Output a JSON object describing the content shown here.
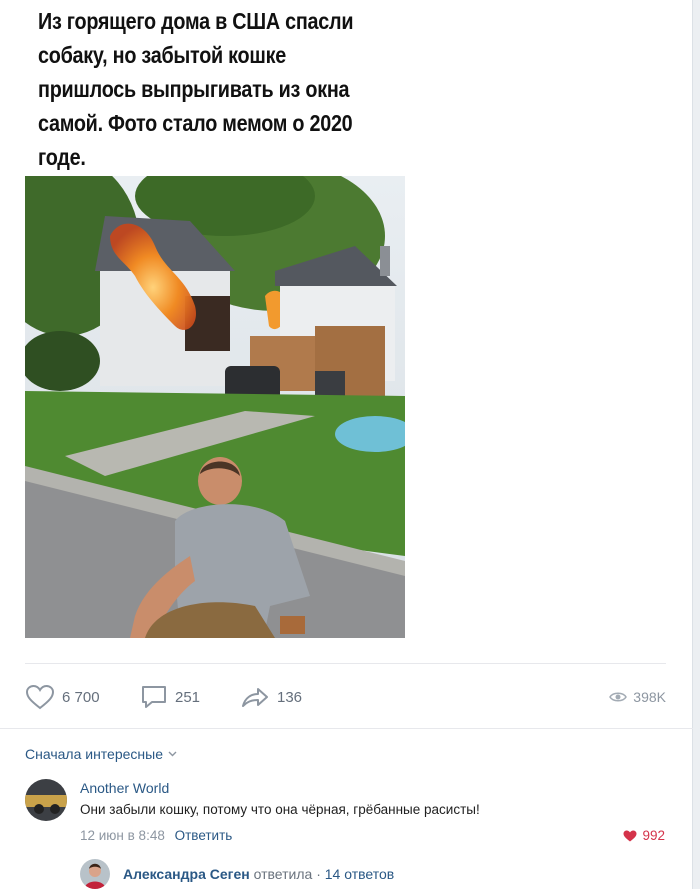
{
  "post": {
    "text_lines": [
      "Из горящего дома в США спасли",
      "собаку, но забытой кошке",
      "пришлось выпрыгивать из окна",
      "самой. Фото стало мемом о 2020",
      "годе."
    ]
  },
  "actions": {
    "likes": "6 700",
    "comments": "251",
    "shares": "136",
    "views": "398K"
  },
  "comments_section": {
    "sort_label": "Сначала интересные"
  },
  "comment": {
    "author": "Another World",
    "text": "Они забыли кошку, потому что она чёрная, грёбанные расисты!",
    "date": "12 июн в 8:48",
    "reply_label": "Ответить",
    "likes": "992"
  },
  "reply_thread": {
    "name": "Александра Сеген",
    "verb": "ответила",
    "separator": "·",
    "count_label": "14 ответов"
  },
  "colors": {
    "link": "#2a5885",
    "muted": "#656f7c",
    "like_red": "#d4334a"
  }
}
